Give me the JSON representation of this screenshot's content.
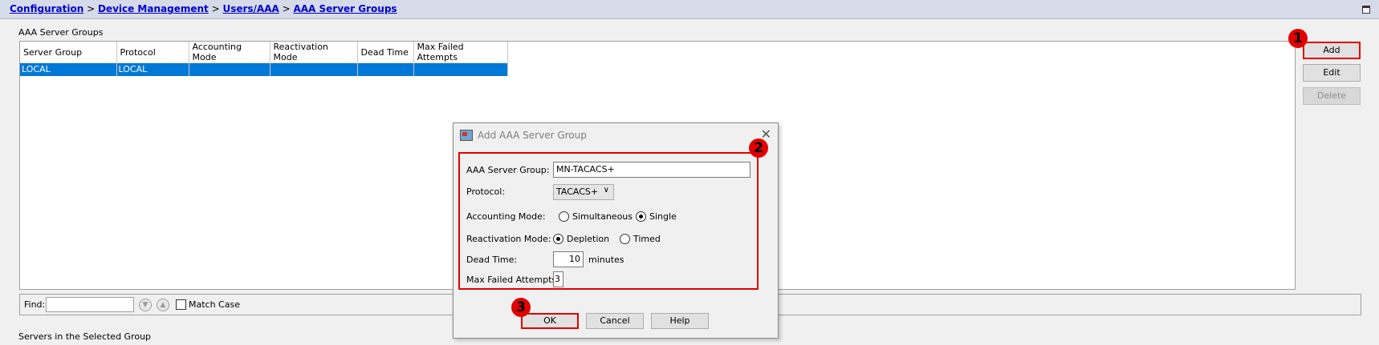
{
  "breadcrumb": {
    "part1": "Configuration",
    "sep1": " > ",
    "part2": "Device Management",
    "sep2": " > ",
    "part3": "Users/AAA",
    "sep3": " > ",
    "part4": "AAA Server Groups"
  },
  "groups_section": {
    "title": "AAA Server Groups",
    "columns": [
      "Server Group",
      "Protocol",
      "Accounting Mode",
      "Reactivation Mode",
      "Dead Time",
      "Max Failed Attempts"
    ],
    "rows": [
      [
        "LOCAL",
        "LOCAL",
        "",
        "",
        "",
        ""
      ]
    ]
  },
  "side_buttons": {
    "add": "Add",
    "edit": "Edit",
    "delete": "Delete"
  },
  "find_bar": {
    "label": "Find:",
    "value": "",
    "match_case": "Match Case"
  },
  "servers_section": {
    "title": "Servers in the Selected Group"
  },
  "dialog": {
    "title": "Add AAA Server Group",
    "server_group_label": "AAA Server Group:",
    "server_group_value": "MN-TACACS+",
    "protocol_label": "Protocol:",
    "protocol_value": "TACACS+",
    "accounting_label": "Accounting Mode:",
    "accounting_options": [
      "Simultaneous",
      "Single"
    ],
    "accounting_selected": "Single",
    "reactivation_label": "Reactivation Mode:",
    "reactivation_options": [
      "Depletion",
      "Timed"
    ],
    "reactivation_selected": "Depletion",
    "dead_time_label": "Dead Time:",
    "dead_time_value": "10",
    "dead_time_unit": "minutes",
    "max_failed_label": "Max Failed Attempts:",
    "max_failed_value": "3",
    "ok": "OK",
    "cancel": "Cancel",
    "help": "Help"
  },
  "callouts": [
    "1",
    "2",
    "3"
  ],
  "colors": {
    "selection": "#0078d7",
    "highlight": "#e00000",
    "link": "#0000cc"
  }
}
